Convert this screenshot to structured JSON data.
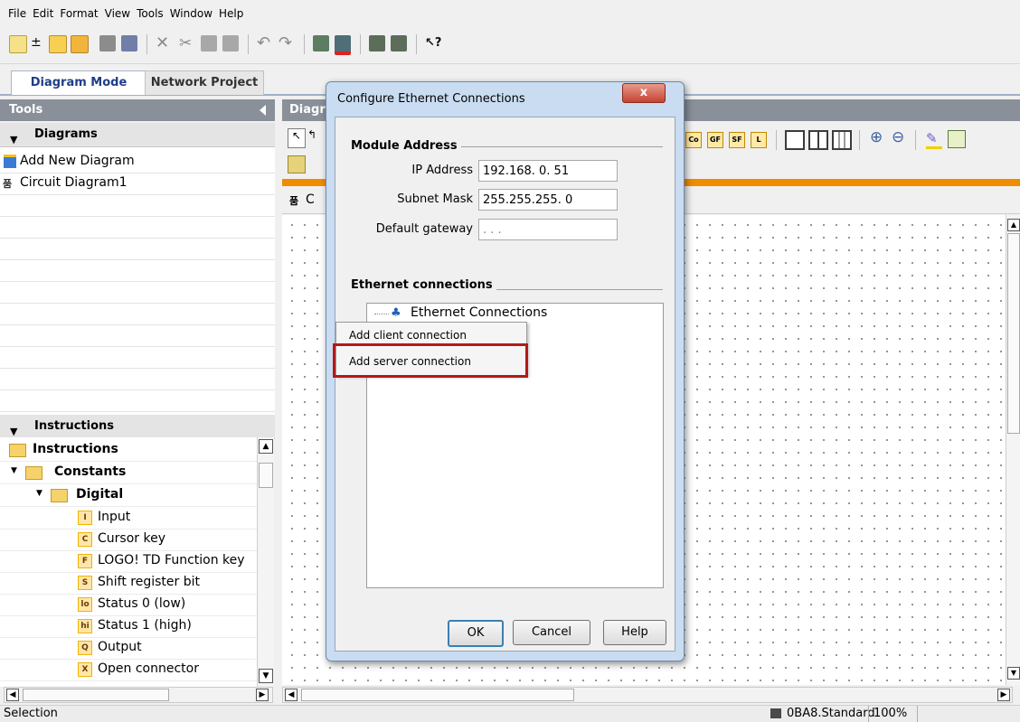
{
  "menubar": {
    "items": [
      "File",
      "Edit",
      "Format",
      "View",
      "Tools",
      "Window",
      "Help"
    ]
  },
  "tabs": [
    {
      "label": "Diagram Mode"
    },
    {
      "label": "Network Project"
    }
  ],
  "tools_panel": {
    "title": "Tools",
    "diagrams_section": {
      "label": "Diagrams",
      "items": [
        "Add New Diagram",
        "Circuit Diagram1"
      ]
    },
    "instructions_section": {
      "label": "Instructions"
    },
    "tree": {
      "root": "Instructions",
      "constants": "Constants",
      "digital": "Digital",
      "items": [
        {
          "badge": "I",
          "label": "Input"
        },
        {
          "badge": "C",
          "label": "Cursor key"
        },
        {
          "badge": "F",
          "label": "LOGO! TD Function key"
        },
        {
          "badge": "S",
          "label": "Shift register bit"
        },
        {
          "badge": "lo",
          "label": "Status 0 (low)"
        },
        {
          "badge": "hi",
          "label": "Status 1 (high)"
        },
        {
          "badge": "Q",
          "label": "Output"
        },
        {
          "badge": "X",
          "label": "Open connector"
        }
      ]
    }
  },
  "diagram_area": {
    "header": "Diagr",
    "circuit_tab_prefix": "C",
    "toolbar_labels": [
      "Co",
      "GF",
      "SF",
      "L"
    ]
  },
  "dialog": {
    "title": "Configure Ethernet Connections",
    "close": "x",
    "module_address": {
      "label": "Module Address",
      "ip_label": "IP Address",
      "ip_value": "192.168.  0. 51",
      "subnet_label": "Subnet Mask",
      "subnet_value": "255.255.255.  0",
      "gateway_label": "Default gateway",
      "gateway_value": ".   .   ."
    },
    "ethernet_connections": {
      "label": "Ethernet connections",
      "root": "Ethernet Connections"
    },
    "context_menu": [
      "Add client connection",
      "Add server connection"
    ],
    "buttons": {
      "ok": "OK",
      "cancel": "Cancel",
      "help": "Help"
    }
  },
  "statusbar": {
    "left": "Selection",
    "device": "0BA8.Standard",
    "zoom": "100%"
  },
  "colors": {
    "accent_blue": "#1f3d88",
    "orange_bar": "#f08c00",
    "highlight_red": "#b41818"
  }
}
